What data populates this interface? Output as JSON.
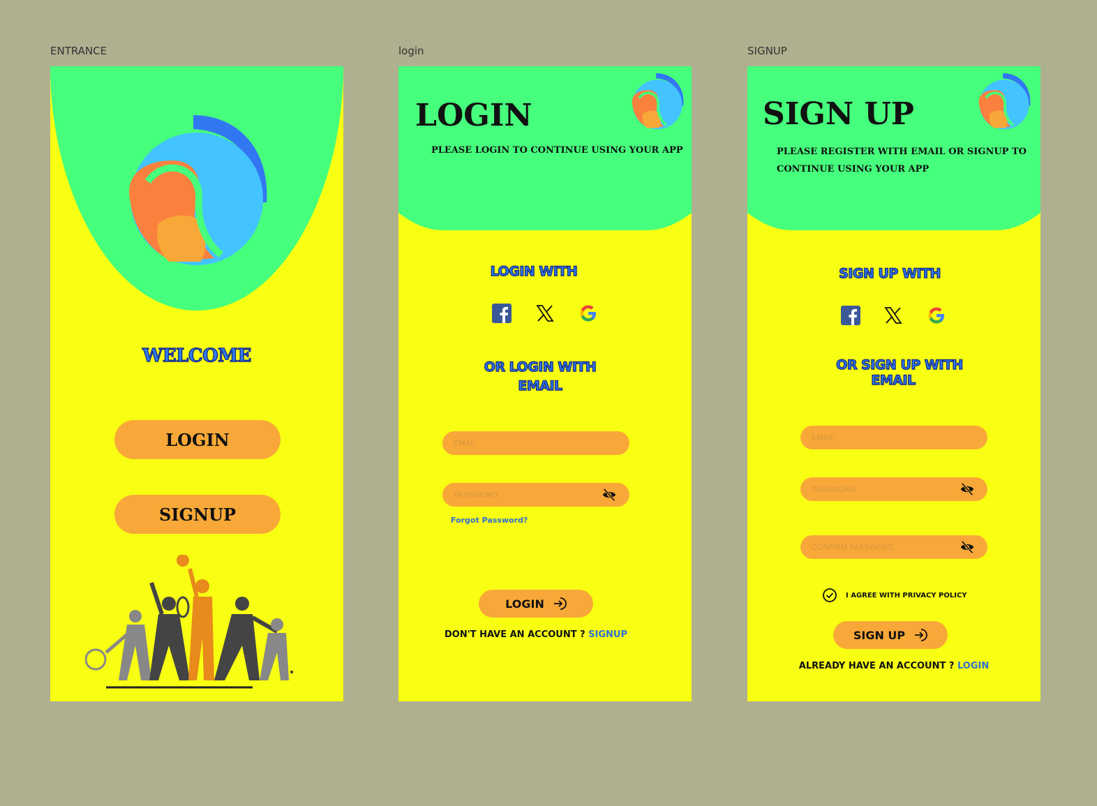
{
  "colors": {
    "canvas": "#afb08f",
    "screen_bg": "#f8ff12",
    "header_green": "#46ff7c",
    "button_orange": "#f8a838",
    "accent_blue": "#2f7cf0",
    "link_blue": "#2f6fd0"
  },
  "frames": {
    "entrance": {
      "label": "ENTRANCE",
      "welcome": "WELCOME",
      "login_button": "LOGIN",
      "signup_button": "SIGNUP"
    },
    "login": {
      "label": "login",
      "title": "LOGIN",
      "subtitle": "PLEASE LOGIN TO CONTINUE USING YOUR APP",
      "social_heading": "LOGIN WITH",
      "social_icons": [
        "facebook-icon",
        "x-icon",
        "google-icon"
      ],
      "email_heading_line1": "OR LOGIN WITH",
      "email_heading_line2": "EMAIL",
      "email_placeholder": "EMAIL",
      "password_placeholder": "PASSWORD",
      "forgot_password": "Forgot Password?",
      "submit_label": "LOGIN",
      "footer_text": "DON'T HAVE  AN ACCOUNT ? ",
      "footer_link": "SIGNUP"
    },
    "signup": {
      "label": "SIGNUP",
      "title": "SIGN UP",
      "subtitle_line1": "PLEASE REGISTER WITH EMAIL OR SIGNUP TO",
      "subtitle_line2": "CONTINUE USING YOUR APP",
      "social_heading": "SIGN UP WITH",
      "social_icons": [
        "facebook-icon",
        "x-icon",
        "google-icon"
      ],
      "email_heading_line1": "OR SIGN UP WITH",
      "email_heading_line2": "EMAIL",
      "email_placeholder": "EMAIL",
      "password_placeholder": "PASSWORD",
      "confirm_placeholder": "CONFIRM PASSWORD",
      "agree_label": "I AGREE WITH PRIVACY POLICY",
      "submit_label": "SIGN UP",
      "footer_text": "ALREADY HAVE  AN ACCOUNT ? ",
      "footer_link": "LOGIN"
    }
  }
}
